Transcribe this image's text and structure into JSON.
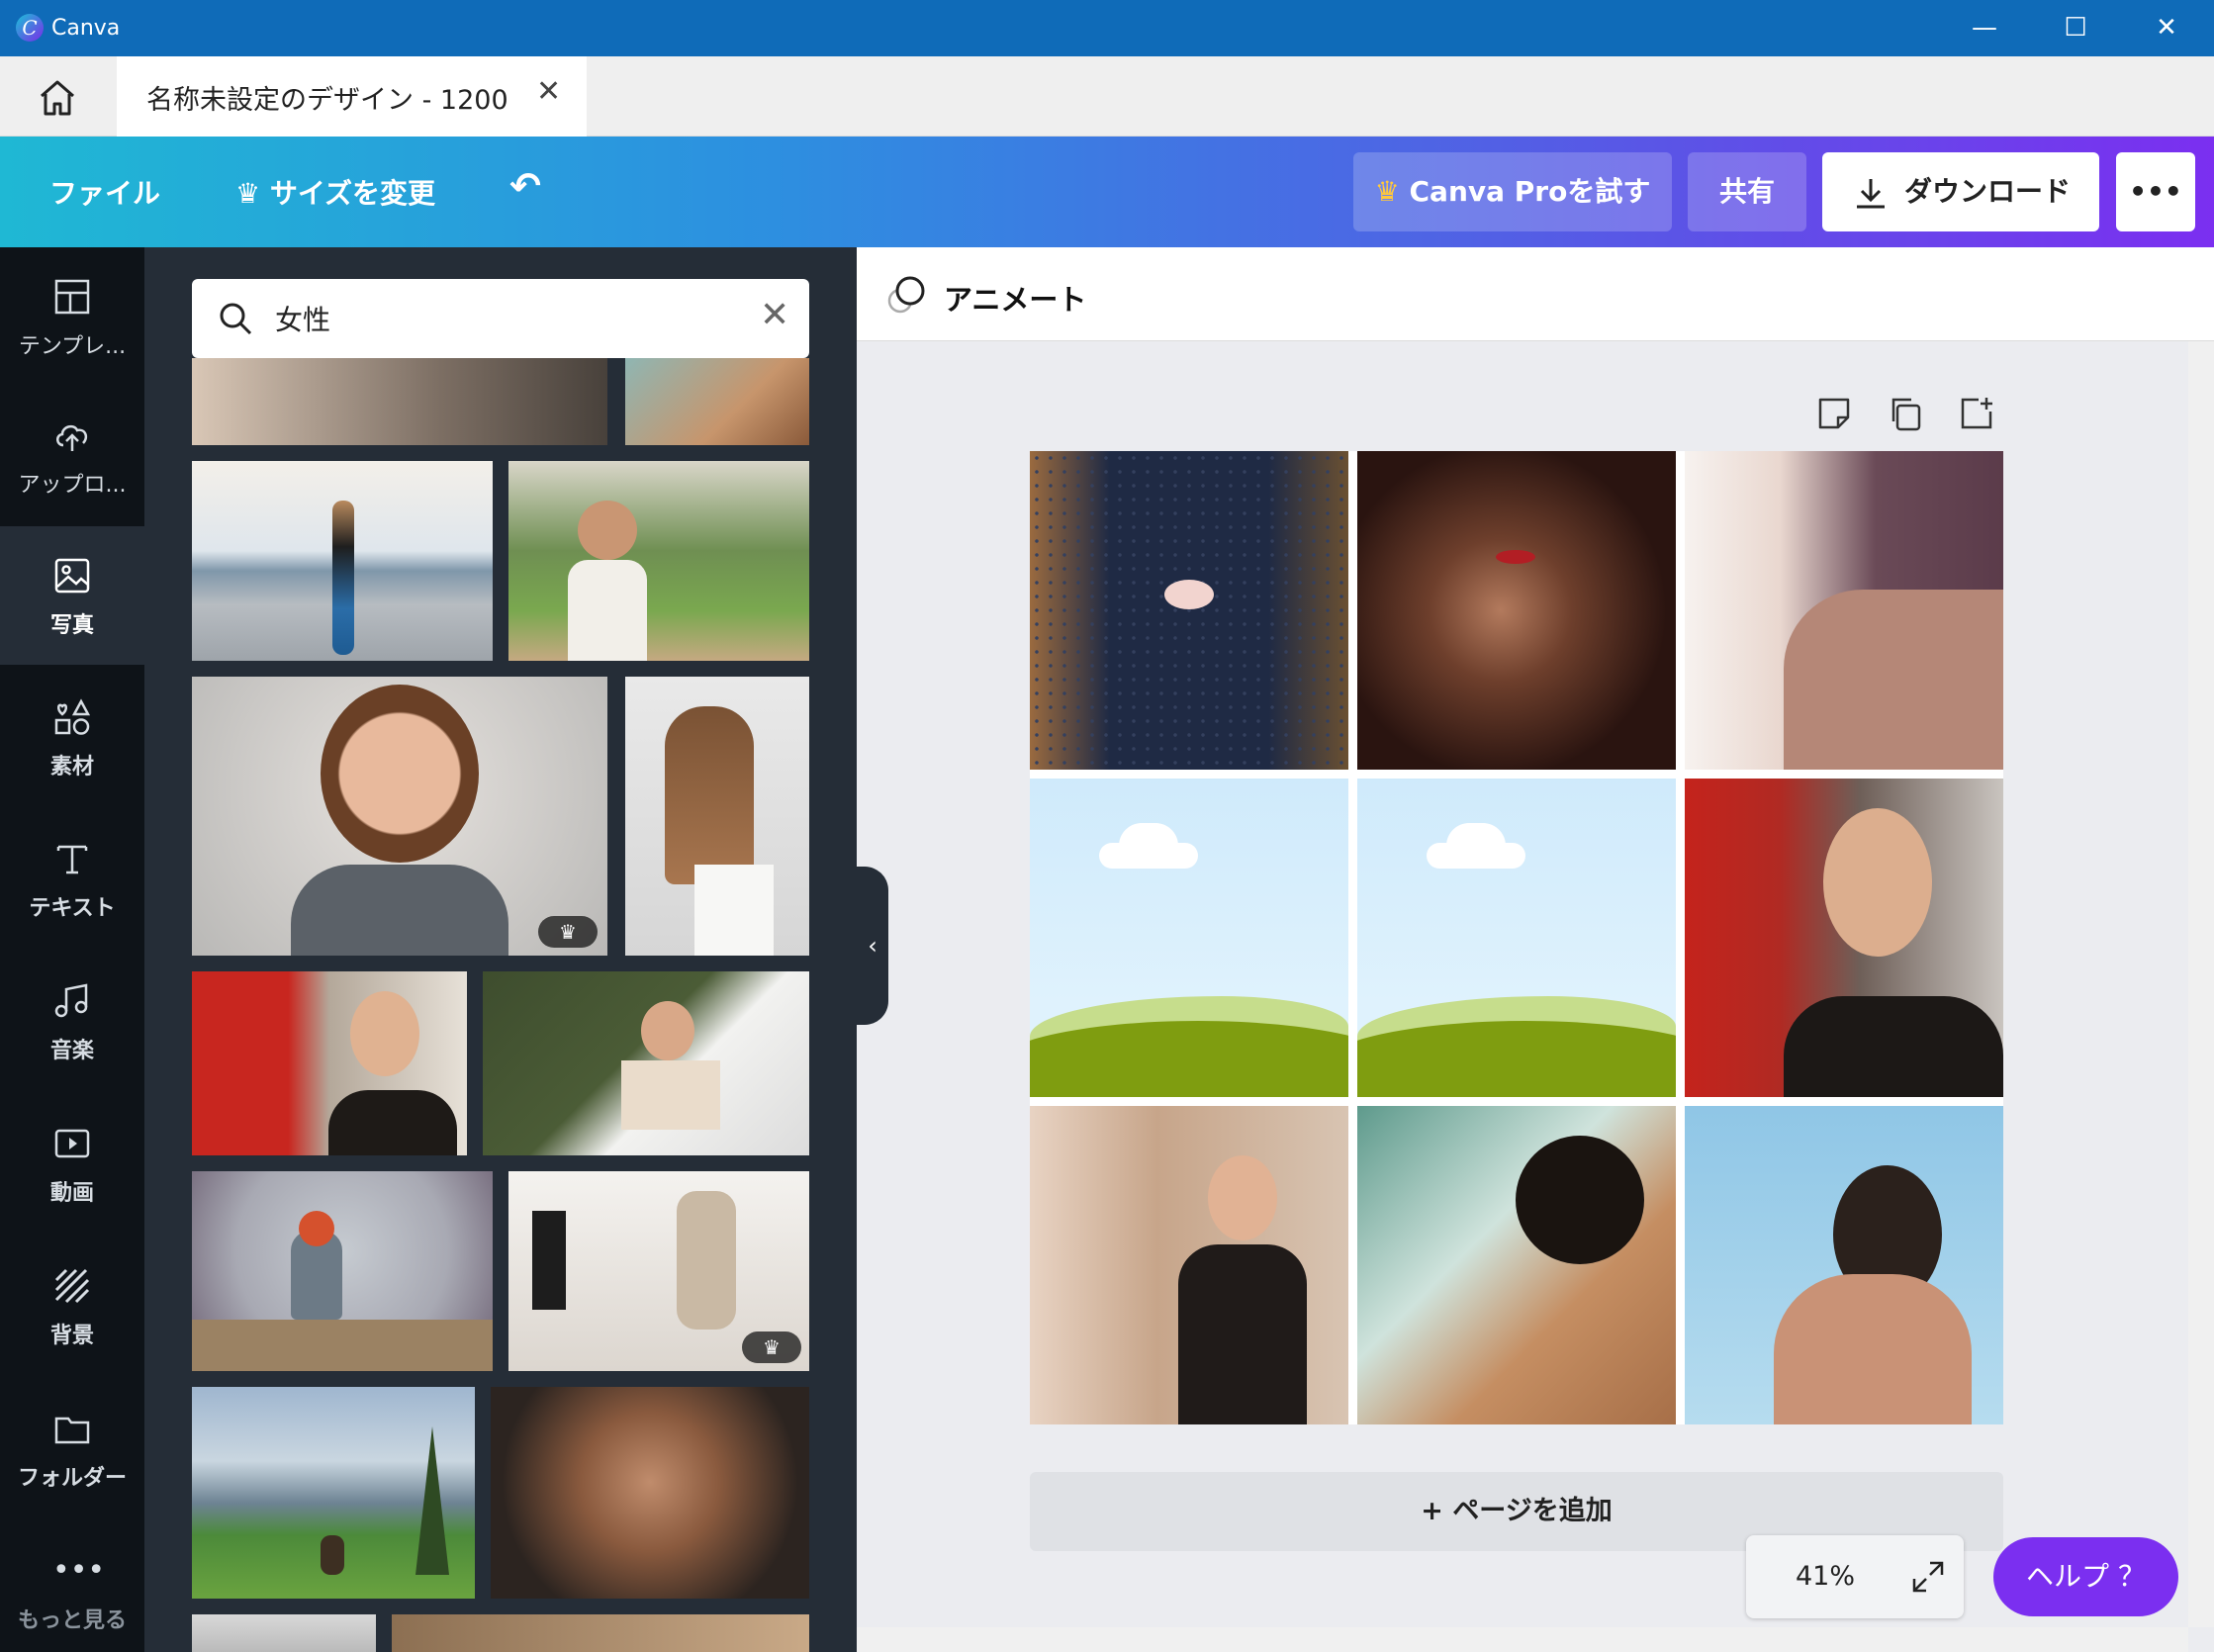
{
  "window": {
    "app_name": "Canva",
    "minimize": "—",
    "maximize": "☐",
    "close": "✕"
  },
  "tabs": {
    "doc_title": "名称未設定のデザイン - 1200",
    "close": "✕"
  },
  "toolbar": {
    "file": "ファイル",
    "resize": "サイズを変更",
    "undo": "↶",
    "pro": "Canva Proを試す",
    "share": "共有",
    "download": "ダウンロード",
    "more": "•••"
  },
  "sidebar": {
    "items": [
      {
        "label": "テンプレ..."
      },
      {
        "label": "アップロ..."
      },
      {
        "label": "写真"
      },
      {
        "label": "素材"
      },
      {
        "label": "テキスト"
      },
      {
        "label": "音楽"
      },
      {
        "label": "動画"
      },
      {
        "label": "背景"
      },
      {
        "label": "フォルダー"
      },
      {
        "label": "もっと見る"
      }
    ]
  },
  "search": {
    "value": "女性"
  },
  "canvas": {
    "animate": "アニメート",
    "add_page": "+ ページを追加",
    "zoom": "41%",
    "help": "ヘルプ ？"
  },
  "colors": {
    "accent": "#7b2ff0",
    "titlebar": "#0f6bb8",
    "panel": "#252d37",
    "rail": "#0e1318"
  }
}
